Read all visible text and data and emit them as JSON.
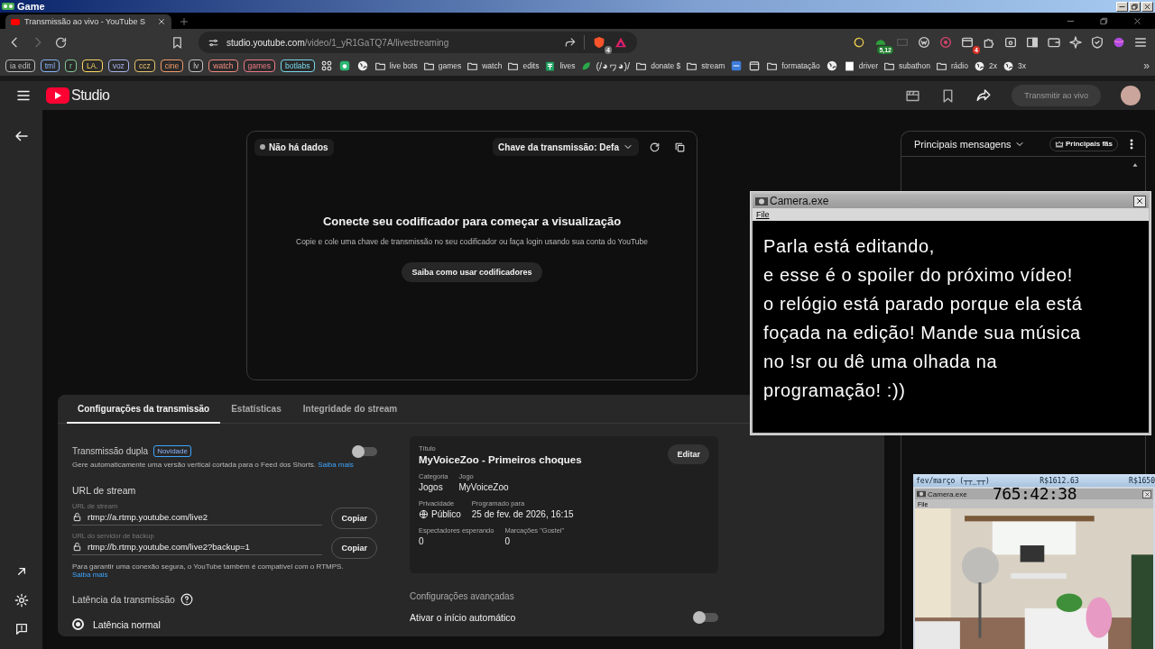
{
  "game_window": {
    "title": "Game"
  },
  "browser": {
    "tabs": [
      {
        "title": "Transmissão ao vivo - YouTube S",
        "selected": true
      }
    ],
    "url": {
      "host": "studio.youtube.com",
      "path": "/video/1_yR1GaTQ7A/livestreaming"
    },
    "address_extensions": [
      {
        "kind": "lion",
        "badge": "4"
      },
      {
        "kind": "triangle"
      }
    ],
    "extensions": [
      {
        "kind": "moon"
      },
      {
        "kind": "dome",
        "badge": "5,12"
      },
      {
        "kind": "dim"
      },
      {
        "kind": "ring"
      },
      {
        "kind": "target"
      },
      {
        "kind": "window",
        "badge": "4"
      },
      {
        "kind": "puzzle"
      },
      {
        "kind": "reader"
      },
      {
        "kind": "sidebar"
      },
      {
        "kind": "wallet"
      },
      {
        "kind": "sparkle"
      },
      {
        "kind": "shield"
      },
      {
        "kind": "orb"
      },
      {
        "kind": "menu"
      }
    ]
  },
  "bookmarks": {
    "chips": [
      {
        "label": "ia edit",
        "color": "#bdbdbd"
      },
      {
        "label": "tml",
        "color": "#8ab4f8"
      },
      {
        "label": "r",
        "color": "#81c995"
      },
      {
        "label": "LA.",
        "color": "#fdd663"
      },
      {
        "label": "voz",
        "color": "#a8b4f0"
      },
      {
        "label": "ccz",
        "color": "#e8c36a"
      },
      {
        "label": "cine",
        "color": "#f29b6a"
      },
      {
        "label": "lv",
        "color": "#c4c4c4"
      },
      {
        "label": "watch",
        "color": "#f28b82"
      },
      {
        "label": "games",
        "color": "#ee7a86"
      },
      {
        "label": "botlabs",
        "color": "#78d9ec"
      }
    ],
    "items": [
      {
        "kind": "grid"
      },
      {
        "kind": "app"
      },
      {
        "kind": "globe"
      },
      {
        "kind": "folder",
        "label": "live bots"
      },
      {
        "kind": "folder",
        "label": "games"
      },
      {
        "kind": "folder",
        "label": "watch"
      },
      {
        "kind": "folder",
        "label": "edits"
      },
      {
        "kind": "sheet",
        "label": "lives"
      },
      {
        "kind": "leaf",
        "label": "(/◕ヮ◕)/"
      },
      {
        "kind": "folder",
        "label": "donate $"
      },
      {
        "kind": "folder",
        "label": "stream"
      },
      {
        "kind": "app2"
      },
      {
        "kind": "calendar"
      },
      {
        "kind": "folder",
        "label": "formatação"
      },
      {
        "kind": "globe"
      },
      {
        "kind": "page",
        "label": "driver"
      },
      {
        "kind": "folder",
        "label": "subathon"
      },
      {
        "kind": "folder",
        "label": "rádio"
      },
      {
        "kind": "globe",
        "label": "2x"
      },
      {
        "kind": "globe",
        "label": "3x"
      }
    ],
    "overflow": "»"
  },
  "studio": {
    "logo": "Studio",
    "go_live": {
      "label": "Transmitir ao vivo",
      "disabled": true
    }
  },
  "preview": {
    "status": "Não há dados",
    "stream_key": "Chave da transmissão: Defa",
    "heading": "Conecte seu codificador para começar a visualização",
    "description": "Copie e cole uma chave de transmissão no seu codificador ou faça login usando sua conta do YouTube",
    "button": "Saiba como usar codificadores"
  },
  "config": {
    "tabs": [
      {
        "label": "Configurações da transmissão",
        "selected": true
      },
      {
        "label": "Estatísticas",
        "selected": false
      },
      {
        "label": "Integridade do stream",
        "selected": false
      }
    ],
    "dual": {
      "label": "Transmissão dupla",
      "tag": "Novidade",
      "on": false,
      "description": "Gere automaticamente uma versão vertical cortada para o Feed dos Shorts.",
      "link": "Saiba mais"
    },
    "stream_url": {
      "heading": "URL de stream",
      "fields": [
        {
          "label": "URL de stream",
          "value": "rtmp://a.rtmp.youtube.com/live2",
          "button": "Copiar"
        },
        {
          "label": "URL do servidor de backup",
          "value": "rtmp://b.rtmp.youtube.com/live2?backup=1",
          "button": "Copiar"
        }
      ],
      "note": "Para garantir uma conexão segura, o YouTube também é compatível com o RTMPS.",
      "link": "Saiba mais"
    },
    "latency": {
      "heading": "Latência da transmissão",
      "options": [
        {
          "label": "Latência normal",
          "selected": true
        }
      ]
    },
    "details": {
      "title_label": "Título",
      "title": "MyVoiceZoo - Primeiros choques",
      "edit": "Editar",
      "rows": [
        [
          {
            "kind": "text",
            "label": "Categoria",
            "value": "Jogos"
          },
          {
            "kind": "text",
            "label": "Jogo",
            "value": "MyVoiceZoo"
          }
        ],
        [
          {
            "kind": "privacy",
            "label": "Privacidade",
            "value": "Público"
          },
          {
            "kind": "text",
            "label": "Programado para",
            "value": "25 de fev. de 2026, 16:15"
          }
        ],
        [
          {
            "kind": "text",
            "label": "Espectadores esperando",
            "value": "0"
          },
          {
            "kind": "text",
            "label": "Marcações \"Gostei\"",
            "value": "0"
          }
        ]
      ]
    },
    "advanced": {
      "heading": "Configurações avançadas",
      "auto_start": {
        "label": "Ativar o início automático",
        "on": false
      }
    }
  },
  "chat": {
    "filter": "Principais mensagens",
    "chip": "Principais fãs"
  },
  "camera_window": {
    "title": "Camera.exe",
    "menu": [
      "File"
    ],
    "lines": [
      "Parla está editando,",
      "e esse é o spoiler do próximo vídeo!",
      "o relógio está parado porque ela está",
      "foçada na edição! Mande sua música",
      "no !sr ou dê uma olhada na",
      "programação!  :))"
    ]
  },
  "mini_overlay": {
    "header": [
      "fev/março (┬┬_┬┬)",
      "R$1612.63",
      "R$1650"
    ],
    "window_title": "Camera.exe",
    "timer": "765:42:38",
    "menu": [
      "File"
    ]
  }
}
